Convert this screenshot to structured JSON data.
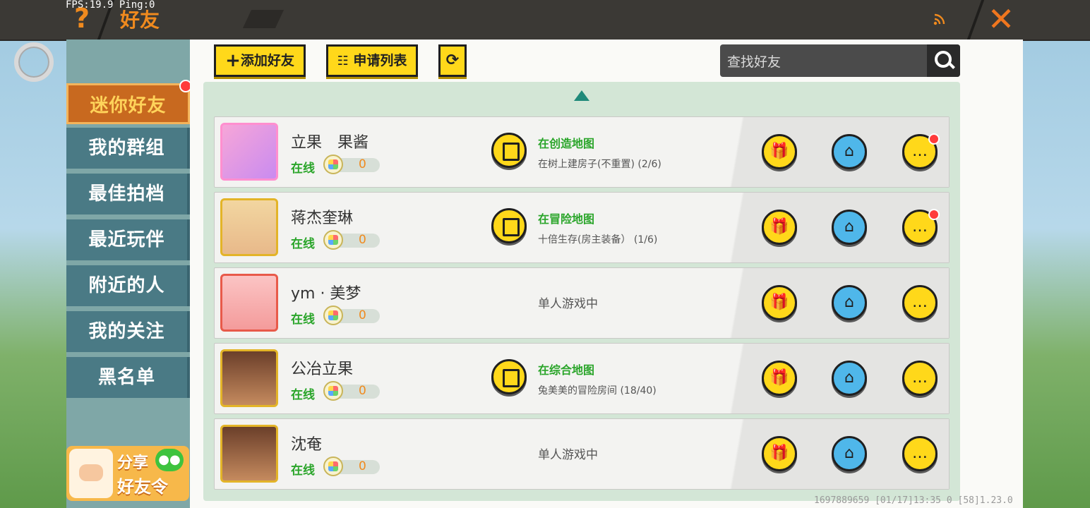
{
  "hud": {
    "fps": "FPS:19.9  Ping:0"
  },
  "header": {
    "help_symbol": "?",
    "title": "好友",
    "close_symbol": "✕"
  },
  "sidebar": {
    "items": [
      {
        "label": "迷你好友",
        "active": true,
        "has_badge": true
      },
      {
        "label": "我的群组"
      },
      {
        "label": "最佳拍档"
      },
      {
        "label": "最近玩伴"
      },
      {
        "label": "附近的人"
      },
      {
        "label": "我的关注"
      },
      {
        "label": "黑名单"
      }
    ],
    "share": {
      "line1": "分享",
      "line2": "好友令"
    }
  },
  "toolbar": {
    "add_friend": "添加好友",
    "request_list": "申请列表",
    "search_placeholder": "查找好友"
  },
  "friends": [
    {
      "name": "立果　果酱",
      "status": "在线",
      "score": "0",
      "map": "在创造地图",
      "room": "在树上建房子(不重置) (2/6)",
      "chat_badge": true
    },
    {
      "name": "蒋杰奎琳",
      "status": "在线",
      "score": "0",
      "map": "在冒险地图",
      "room": "十倍生存(房主装备） (1/6)",
      "chat_badge": true
    },
    {
      "name": "ym · 美梦",
      "status": "在线",
      "score": "0",
      "solo": "单人游戏中"
    },
    {
      "name": "公冶立果",
      "status": "在线",
      "score": "0",
      "map": "在综合地图",
      "room": "兔美美的冒险房间 (18/40)"
    },
    {
      "name": "沈奄",
      "status": "在线",
      "score": "0",
      "solo": "单人游戏中"
    }
  ],
  "footer": {
    "info": "1697889659   [01/17]13:35 0  [58]1.23.0"
  },
  "colors": {
    "accent": "#f08a1e",
    "online": "#2aa52a",
    "button_yellow": "#ffd81a",
    "home_blue": "#4fb7ea"
  }
}
